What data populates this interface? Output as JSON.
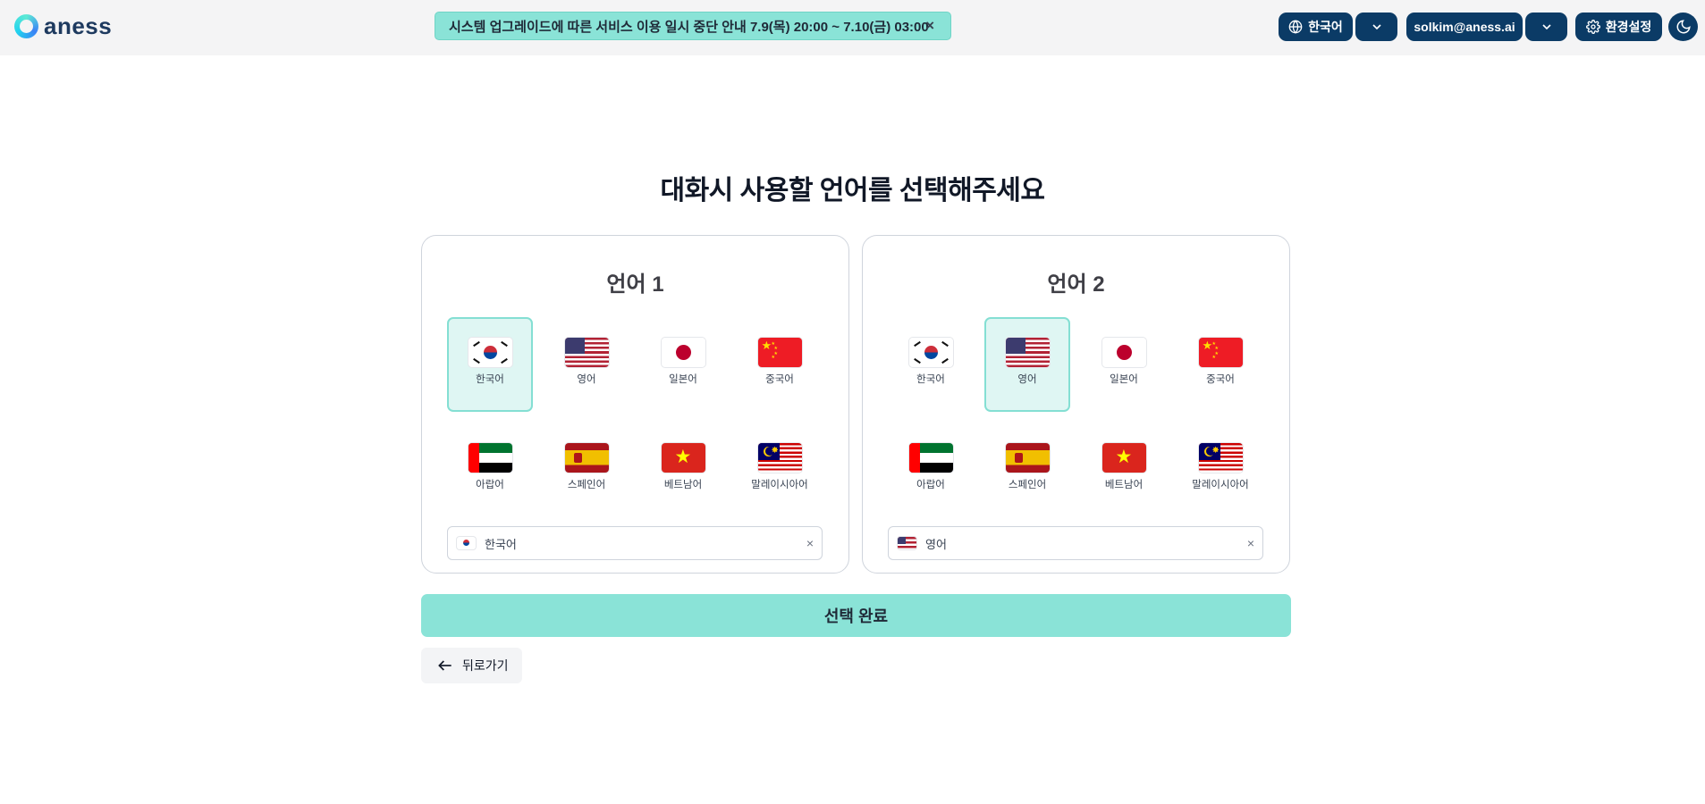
{
  "header": {
    "logo_text": "aness",
    "notice": "시스템 업그레이드에 따른 서비스 이용 일시 중단 안내 7.9(목) 20:00 ~ 7.10(금) 03:00",
    "notice_close": "×",
    "language_label": "한국어",
    "user_email": "solkim@aness.ai",
    "settings_label": "환경설정"
  },
  "main": {
    "heading": "대화시 사용할 언어를 선택해주세요",
    "panel1": {
      "title": "언어 1",
      "selected_label": "한국어"
    },
    "panel2": {
      "title": "언어 2",
      "selected_label": "영어"
    },
    "clear_symbol": "×",
    "confirm_label": "선택 완료",
    "back_label": "뒤로가기"
  },
  "languages": [
    {
      "label": "한국어",
      "flag": "kr"
    },
    {
      "label": "영어",
      "flag": "us"
    },
    {
      "label": "일본어",
      "flag": "jp"
    },
    {
      "label": "중국어",
      "flag": "cn"
    },
    {
      "label": "아랍어",
      "flag": "ae"
    },
    {
      "label": "스페인어",
      "flag": "es"
    },
    {
      "label": "베트남어",
      "flag": "vn"
    },
    {
      "label": "말레이시아어",
      "flag": "my"
    }
  ],
  "colors": {
    "accent": "#8ae3d7",
    "selected_bg": "#dff6f3",
    "navy": "#0b3b66"
  }
}
